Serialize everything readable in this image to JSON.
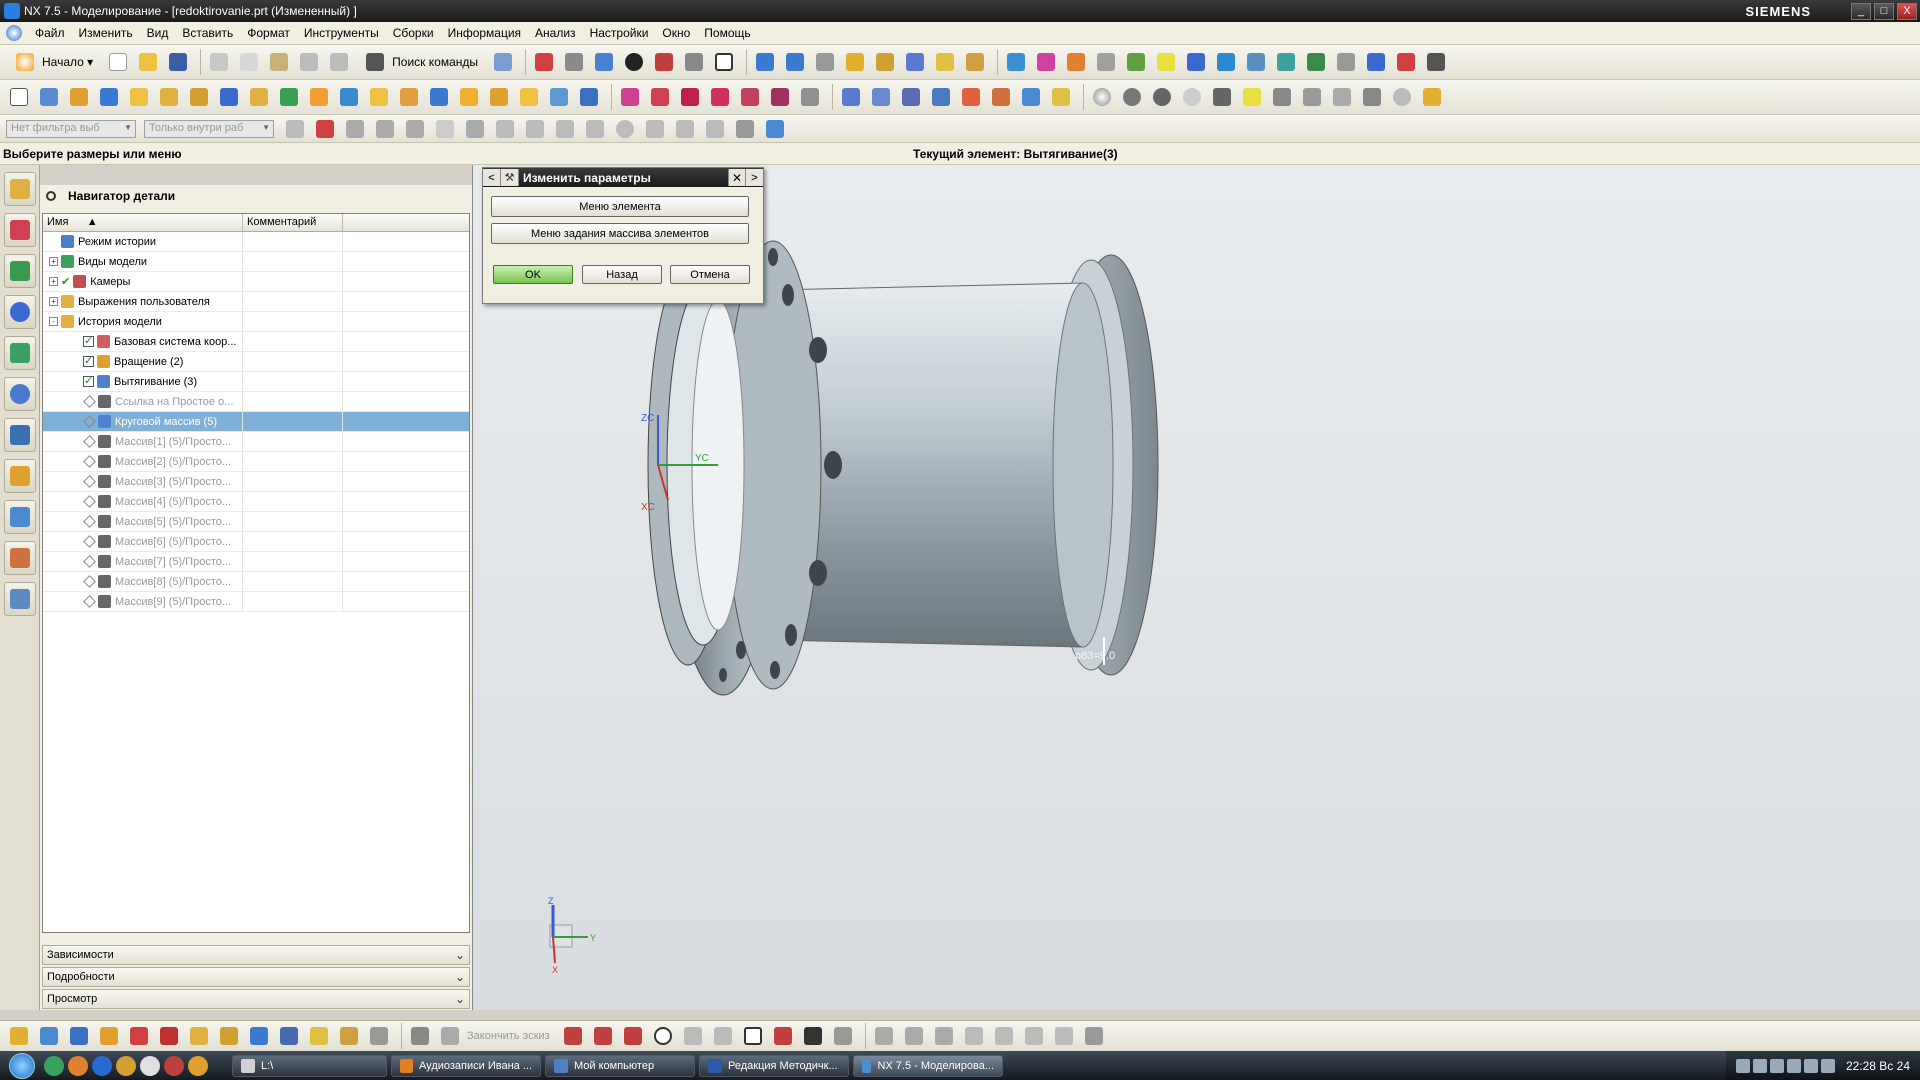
{
  "window": {
    "title": "NX 7.5 - Моделирование - [redoktirovanie.prt (Измененный) ]",
    "brand": "SIEMENS",
    "controls": [
      "_",
      "□",
      "X"
    ]
  },
  "menubar": {
    "items": [
      "Файл",
      "Изменить",
      "Вид",
      "Вставить",
      "Формат",
      "Инструменты",
      "Сборки",
      "Информация",
      "Анализ",
      "Настройки",
      "Окно",
      "Помощь"
    ]
  },
  "toolbar": {
    "start_label": "Начало",
    "search_command_label": "Поиск команды",
    "filter_combo": "Нет фильтра выб",
    "scope_combo": "Только внутри раб"
  },
  "status": {
    "prompt": "Выберите размеры или меню",
    "current_feature": "Текущий элемент: Вытягивание(3)"
  },
  "navigator": {
    "title": "Навигатор детали",
    "columns": [
      "Имя",
      "Комментарий"
    ],
    "rows": [
      {
        "label": "Режим истории",
        "indent": 0,
        "expander": "",
        "check": "",
        "icon": "history-mode-icon",
        "color": "#4a7fc1",
        "state": "normal"
      },
      {
        "label": "Виды модели",
        "indent": 0,
        "expander": "+",
        "check": "",
        "icon": "model-views-icon",
        "color": "#3aa05a",
        "state": "normal"
      },
      {
        "label": "Камеры",
        "indent": 0,
        "expander": "+",
        "check": "tick",
        "icon": "cameras-icon",
        "color": "#c05050",
        "state": "normal"
      },
      {
        "label": "Выражения пользователя",
        "indent": 0,
        "expander": "+",
        "check": "",
        "icon": "folder-icon",
        "color": "#e0b040",
        "state": "normal"
      },
      {
        "label": "История модели",
        "indent": 0,
        "expander": "-",
        "check": "",
        "icon": "folder-open-icon",
        "color": "#e0b040",
        "state": "normal"
      },
      {
        "label": "Базовая система коор...",
        "indent": 1,
        "expander": "",
        "check": "on",
        "icon": "datum-csys-icon",
        "color": "#d06060",
        "state": "normal"
      },
      {
        "label": "Вращение (2)",
        "indent": 1,
        "expander": "",
        "check": "on",
        "icon": "revolve-icon",
        "color": "#e0a030",
        "state": "normal"
      },
      {
        "label": "Вытягивание (3)",
        "indent": 1,
        "expander": "",
        "check": "on",
        "icon": "extrude-icon",
        "color": "#5080d0",
        "state": "normal"
      },
      {
        "label": "Ссылка на Простое о...",
        "indent": 1,
        "expander": "",
        "check": "diamond",
        "icon": "hole-icon",
        "color": "#666666",
        "state": "suppressed"
      },
      {
        "label": "Круговой массив (5)",
        "indent": 1,
        "expander": "",
        "check": "diamond",
        "icon": "circular-array-icon",
        "color": "#5080d0",
        "state": "selected"
      },
      {
        "label": "Массив[1] (5)/Просто...",
        "indent": 1,
        "expander": "",
        "check": "diamond",
        "icon": "hole-icon",
        "color": "#666666",
        "state": "suppressed"
      },
      {
        "label": "Массив[2] (5)/Просто...",
        "indent": 1,
        "expander": "",
        "check": "diamond",
        "icon": "hole-icon",
        "color": "#666666",
        "state": "suppressed"
      },
      {
        "label": "Массив[3] (5)/Просто...",
        "indent": 1,
        "expander": "",
        "check": "diamond",
        "icon": "hole-icon",
        "color": "#666666",
        "state": "suppressed"
      },
      {
        "label": "Массив[4] (5)/Просто...",
        "indent": 1,
        "expander": "",
        "check": "diamond",
        "icon": "hole-icon",
        "color": "#666666",
        "state": "suppressed"
      },
      {
        "label": "Массив[5] (5)/Просто...",
        "indent": 1,
        "expander": "",
        "check": "diamond",
        "icon": "hole-icon",
        "color": "#666666",
        "state": "suppressed"
      },
      {
        "label": "Массив[6] (5)/Просто...",
        "indent": 1,
        "expander": "",
        "check": "diamond",
        "icon": "hole-icon",
        "color": "#666666",
        "state": "suppressed"
      },
      {
        "label": "Массив[7] (5)/Просто...",
        "indent": 1,
        "expander": "",
        "check": "diamond",
        "icon": "hole-icon",
        "color": "#666666",
        "state": "suppressed"
      },
      {
        "label": "Массив[8] (5)/Просто...",
        "indent": 1,
        "expander": "",
        "check": "diamond",
        "icon": "hole-icon",
        "color": "#666666",
        "state": "suppressed"
      },
      {
        "label": "Массив[9] (5)/Просто...",
        "indent": 1,
        "expander": "",
        "check": "diamond",
        "icon": "hole-icon",
        "color": "#666666",
        "state": "suppressed"
      }
    ],
    "panels": [
      "Зависимости",
      "Подробности",
      "Просмотр"
    ]
  },
  "dialog": {
    "title": "Изменить параметры",
    "feature_menu": "Меню элемента",
    "array_menu": "Меню задания массива элементов",
    "ok": "OK",
    "back": "Назад",
    "cancel": "Отмена"
  },
  "graphics": {
    "dimension_label": "p83=9.0",
    "wcs": {
      "z": "ZC",
      "y": "YC",
      "x": "XC"
    },
    "triad": {
      "z": "Z",
      "y": "Y",
      "x": "X"
    }
  },
  "bottom_toolbar": {
    "finish_sketch": "Закончить эскиз"
  },
  "taskbar": {
    "tasks": [
      {
        "label": "L:\\",
        "color": "#d0d0d0"
      },
      {
        "label": "Аудиозаписи Ивана ...",
        "color": "#e08020"
      },
      {
        "label": "Мой компьютер",
        "color": "#5080c0"
      },
      {
        "label": "Редакция Методичк...",
        "color": "#2a5aa8"
      },
      {
        "label": "NX 7.5 - Моделирова...",
        "color": "#4a90d0"
      }
    ],
    "clock": "22:28 Вс 24"
  }
}
